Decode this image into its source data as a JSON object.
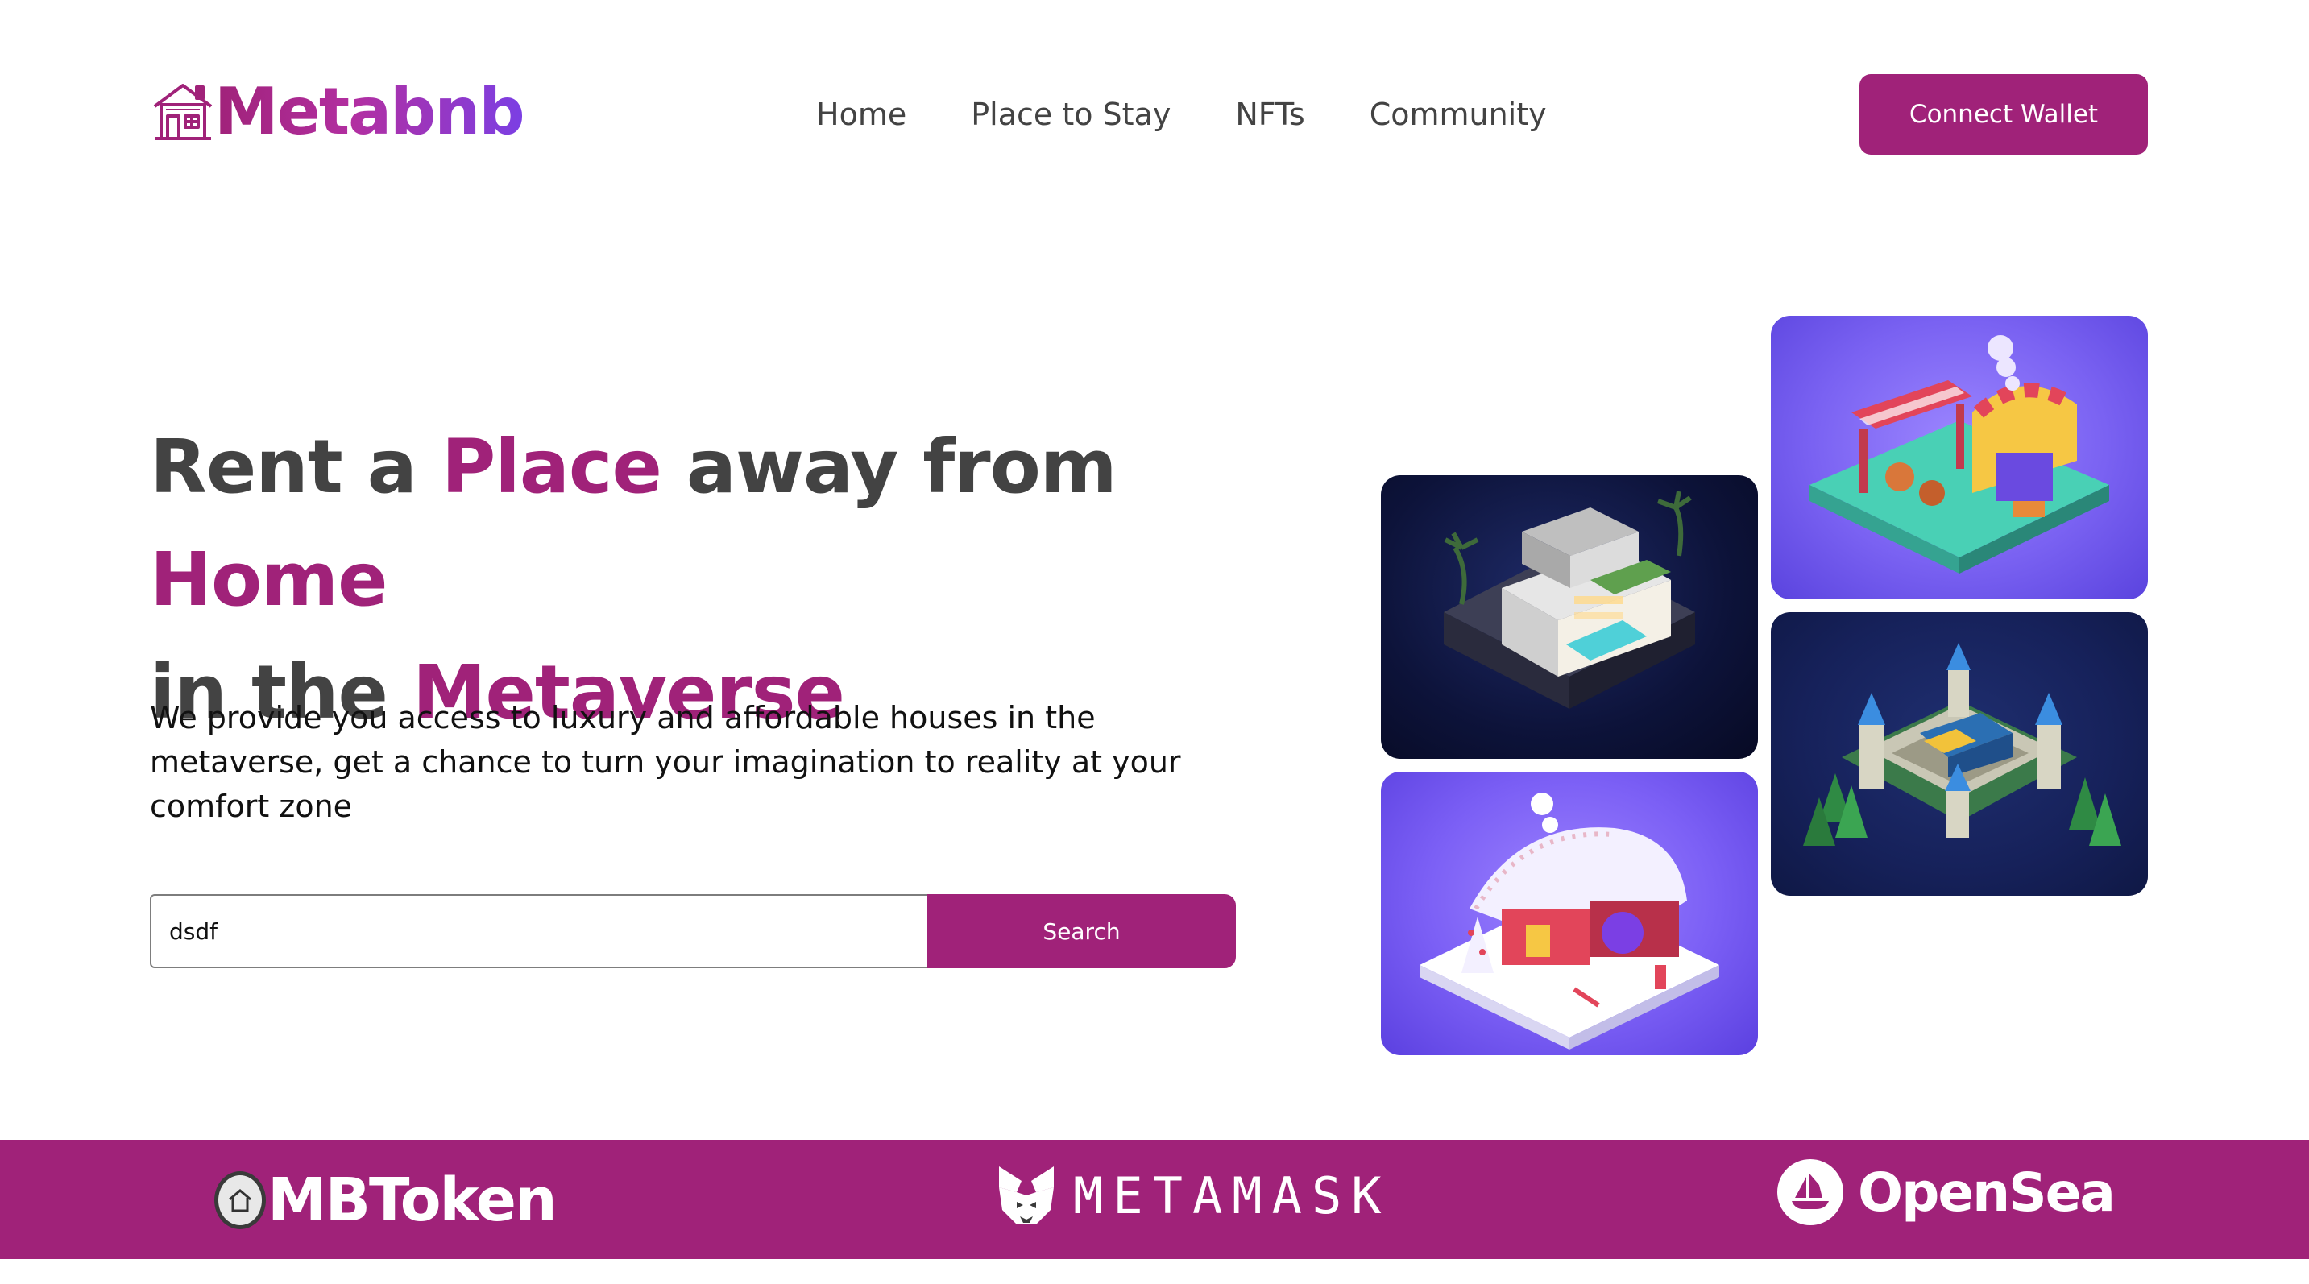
{
  "brand": {
    "name": "Metabnb",
    "icon": "house-icon",
    "colors": {
      "primary": "#a02279",
      "gradient_end": "#7b3fe4",
      "text": "#434343"
    }
  },
  "nav": {
    "items": [
      {
        "label": "Home"
      },
      {
        "label": "Place to Stay"
      },
      {
        "label": "NFTs"
      },
      {
        "label": "Community"
      }
    ],
    "connect_label": "Connect Wallet"
  },
  "hero": {
    "headline": {
      "part1": "Rent a ",
      "accent1": "Place",
      "part2": " away from ",
      "accent2": "Home",
      "part3": "in the ",
      "accent3": "Metaverse"
    },
    "subtext": "We provide you access to luxury and affordable houses in the metaverse, get a chance to turn your imagination to reality at your comfort zone",
    "search": {
      "value": "dsdf",
      "placeholder": "",
      "button_label": "Search"
    }
  },
  "gallery": {
    "tiles": [
      {
        "scene": "modern-villa-night"
      },
      {
        "scene": "market-stalls"
      },
      {
        "scene": "castle-forest"
      },
      {
        "scene": "snowy-cottage"
      }
    ]
  },
  "partners": [
    {
      "name": "MBToken",
      "icon": "mbtoken-coin-icon"
    },
    {
      "name": "METAMASK",
      "icon": "metamask-fox-icon"
    },
    {
      "name": "OpenSea",
      "icon": "opensea-boat-icon"
    }
  ]
}
